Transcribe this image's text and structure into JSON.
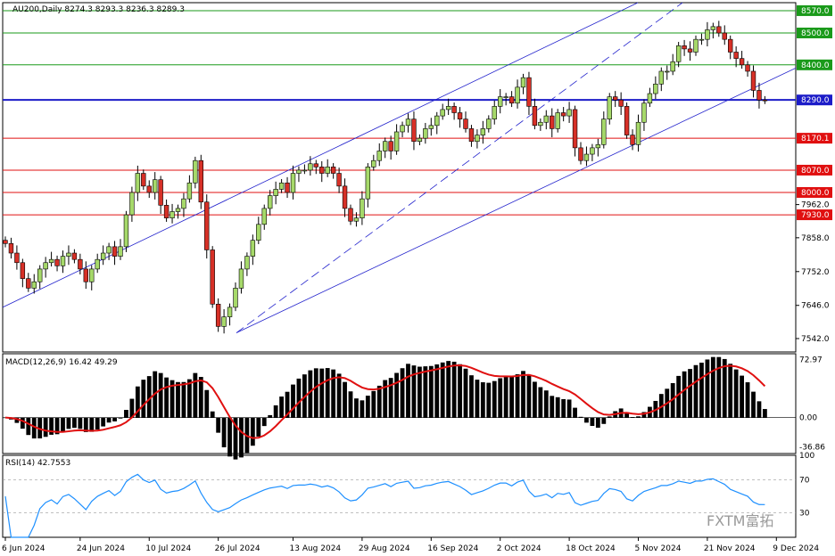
{
  "chart_data": [
    {
      "type": "candlestick",
      "title": "AU200,Daily  8274.3 8293.3 8236.3 8289.3",
      "ylim": [
        7500,
        8595
      ],
      "horizontal_levels": [
        {
          "label": "8570.0",
          "value": 8570,
          "color": "#1a9a1a"
        },
        {
          "label": "8500.0",
          "value": 8500,
          "color": "#1a9a1a"
        },
        {
          "label": "8400.0",
          "value": 8400,
          "color": "#1a9a1a"
        },
        {
          "label": "8290.0",
          "value": 8290,
          "color": "#1c1cc8"
        },
        {
          "label": "8170.1",
          "value": 8170.1,
          "color": "#e01010"
        },
        {
          "label": "8070.0",
          "value": 8070,
          "color": "#e01010"
        },
        {
          "label": "8000.0",
          "value": 8000,
          "color": "#e01010"
        },
        {
          "label": "7930.0",
          "value": 7930,
          "color": "#e01010"
        }
      ],
      "price_ticks": [
        "7962.0",
        "7858.0",
        "7752.0",
        "7646.0",
        "7542.0"
      ],
      "price_tick_values": [
        7962,
        7858,
        7752,
        7646,
        7542
      ],
      "x_tick_labels": [
        "6 Jun 2024",
        "24 Jun 2024",
        "10 Jul 2024",
        "26 Jul 2024",
        "13 Aug 2024",
        "29 Aug 2024",
        "16 Sep 2024",
        "2 Oct 2024",
        "18 Oct 2024",
        "5 Nov 2024",
        "21 Nov 2024",
        "9 Dec 2024"
      ],
      "x_tick_bar_index": [
        0,
        13,
        25,
        37,
        50,
        62,
        74,
        86,
        98,
        110,
        122,
        134
      ],
      "current_price_label": "8290.0",
      "closes": [
        7840,
        7810,
        7780,
        7730,
        7700,
        7720,
        7760,
        7780,
        7790,
        7770,
        7800,
        7810,
        7790,
        7760,
        7720,
        7760,
        7790,
        7810,
        7830,
        7800,
        7830,
        7930,
        8000,
        8060,
        8020,
        8000,
        8040,
        7960,
        7920,
        7940,
        7950,
        7980,
        8030,
        8100,
        7970,
        7820,
        7650,
        7580,
        7610,
        7640,
        7700,
        7760,
        7800,
        7850,
        7900,
        7950,
        7990,
        8010,
        8030,
        8000,
        8060,
        8070,
        8070,
        8090,
        8080,
        8060,
        8080,
        8060,
        8020,
        7950,
        7910,
        7920,
        7980,
        8080,
        8100,
        8130,
        8160,
        8130,
        8190,
        8210,
        8230,
        8160,
        8170,
        8200,
        8210,
        8240,
        8260,
        8270,
        8250,
        8230,
        8200,
        8160,
        8180,
        8200,
        8230,
        8270,
        8300,
        8300,
        8280,
        8330,
        8360,
        8270,
        8210,
        8220,
        8240,
        8200,
        8250,
        8240,
        8260,
        8140,
        8100,
        8120,
        8140,
        8150,
        8230,
        8300,
        8290,
        8270,
        8180,
        8150,
        8220,
        8280,
        8310,
        8340,
        8380,
        8380,
        8410,
        8460,
        8450,
        8440,
        8480,
        8480,
        8510,
        8520,
        8500,
        8480,
        8440,
        8420,
        8400,
        8380,
        8320,
        8290,
        8289.3
      ],
      "macd": {
        "label": "MACD(12,26,9) 16.42 49.29",
        "ylim": [
          -45,
          80
        ],
        "ticks": [
          "72.97",
          "0.00",
          "-36.86"
        ],
        "tick_values": [
          72.97,
          0,
          -36.86
        ]
      },
      "rsi": {
        "label": "RSI(14) 42.7553",
        "ylim": [
          0,
          100
        ],
        "ticks": [
          "100",
          "70",
          "30"
        ],
        "tick_values": [
          100,
          70,
          30
        ]
      }
    }
  ],
  "watermark": {
    "text": "FXTM富拓"
  }
}
